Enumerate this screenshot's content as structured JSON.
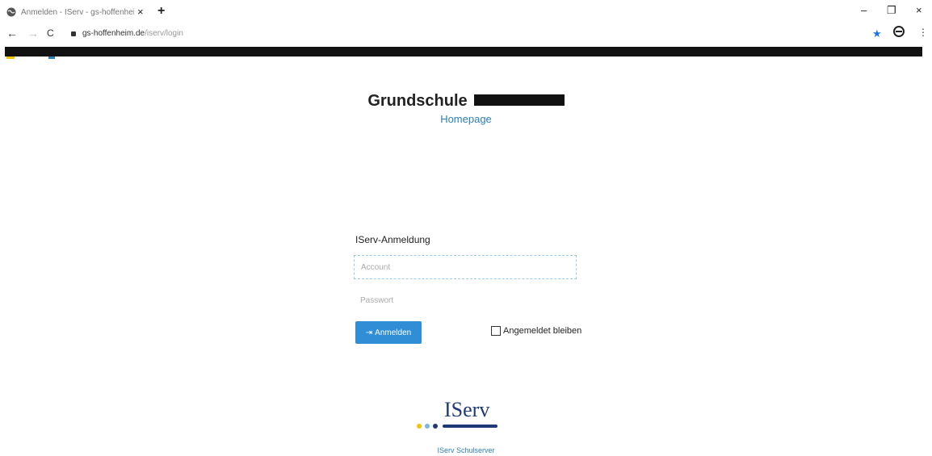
{
  "browser": {
    "tab_title": "Anmelden - IServ - gs-hoffenheim",
    "tab_close": "×",
    "new_tab": "+",
    "url_host": "gs-hoffenheim.de",
    "url_path": "/iserv/login",
    "nav_back": "←",
    "nav_forward": "→",
    "nav_reload": "C",
    "star": "★",
    "menu": "⋮",
    "minimize": "–",
    "maximize": "❐",
    "close": "×"
  },
  "page": {
    "school_title": "Grundschule",
    "homepage_link": "Homepage",
    "login_heading": "IServ-Anmeldung",
    "username_placeholder": "Account",
    "password_placeholder": "Passwort",
    "login_button": "Anmelden",
    "login_icon": "⇥",
    "remember_label": "Angemeldet bleiben"
  },
  "footer": {
    "logo_text": "IServ",
    "caption": "IServ Schulserver"
  },
  "colors": {
    "accent_blue": "#2f8ed6",
    "link_blue": "#2e7fb5",
    "logo_navy": "#1f3a78",
    "logo_dot_yellow": "#f4c400",
    "logo_dot_lightblue": "#7fb2e0"
  }
}
